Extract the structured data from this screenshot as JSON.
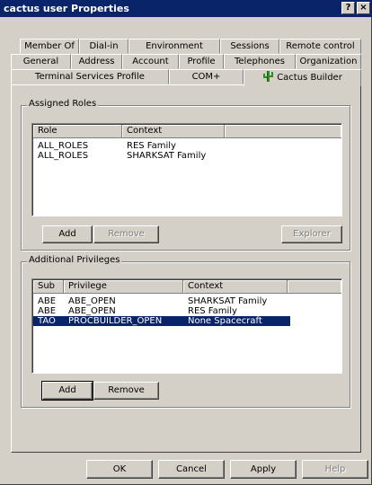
{
  "window": {
    "title": "cactus user Properties",
    "help_glyph": "?",
    "close_glyph": "×"
  },
  "tabs": {
    "row1": [
      "Member Of",
      "Dial-in",
      "Environment",
      "Sessions",
      "Remote control"
    ],
    "row2": [
      "General",
      "Address",
      "Account",
      "Profile",
      "Telephones",
      "Organization"
    ],
    "row3": [
      "Terminal Services Profile",
      "COM+",
      "Cactus Builder"
    ],
    "active": "Cactus Builder"
  },
  "assigned_roles": {
    "label": "Assigned Roles",
    "columns": [
      "Role",
      "Context"
    ],
    "rows": [
      {
        "role": "ALL_ROLES",
        "context": "RES Family"
      },
      {
        "role": "ALL_ROLES",
        "context": "SHARKSAT Family"
      }
    ],
    "buttons": {
      "add": "Add",
      "remove": "Remove",
      "explorer": "Explorer"
    }
  },
  "additional_privileges": {
    "label": "Additional Privileges",
    "columns": [
      "Sub",
      "Privilege",
      "Context"
    ],
    "rows": [
      {
        "sub": "ABE",
        "privilege": "ABE_OPEN",
        "context": "SHARKSAT Family",
        "selected": false
      },
      {
        "sub": "ABE",
        "privilege": "ABE_OPEN",
        "context": "RES Family",
        "selected": false
      },
      {
        "sub": "TAO",
        "privilege": "PROCBUILDER_OPEN",
        "context": "None Spacecraft",
        "selected": true
      }
    ],
    "buttons": {
      "add": "Add",
      "remove": "Remove"
    }
  },
  "dialog_buttons": {
    "ok": "OK",
    "cancel": "Cancel",
    "apply": "Apply",
    "help": "Help"
  },
  "colors": {
    "face": "#d4d0c8",
    "title": "#0a246a",
    "selection": "#0a246a"
  }
}
